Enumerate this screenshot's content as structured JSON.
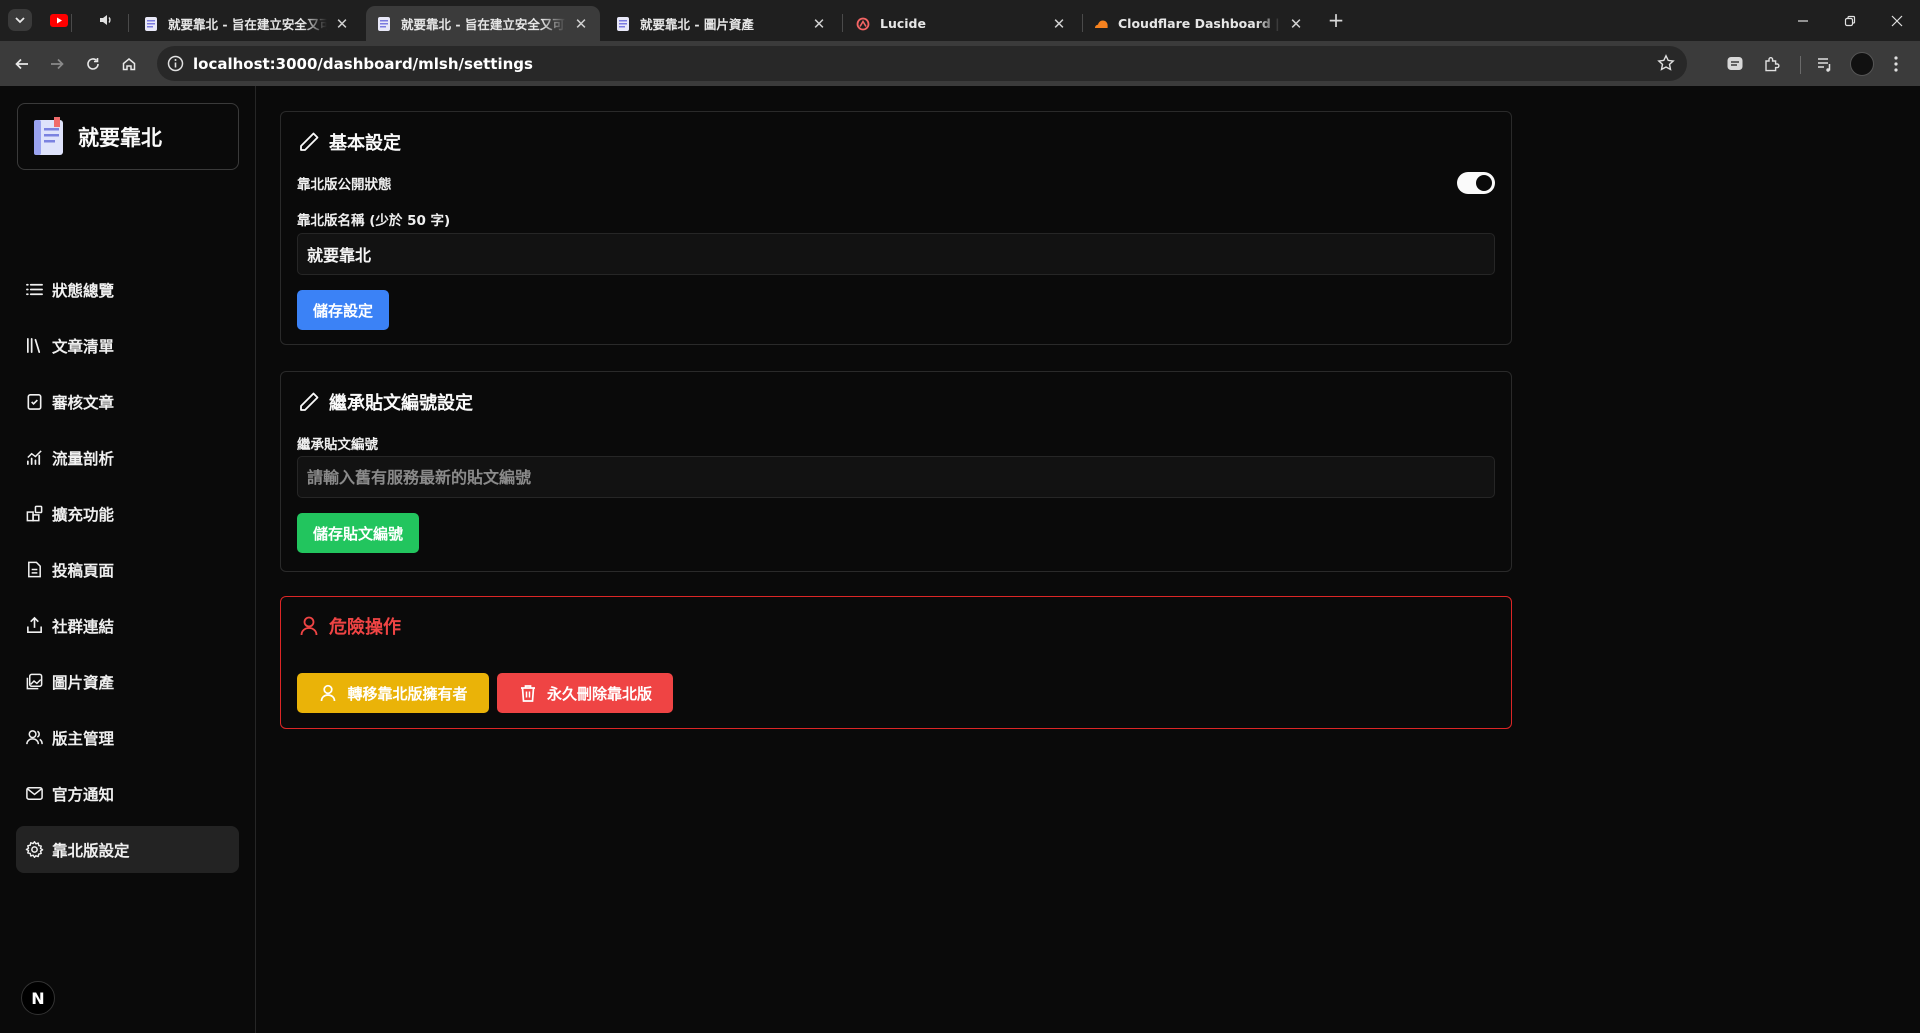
{
  "browser": {
    "tabs": [
      {
        "title": "就要靠北 - 旨在建立安全又可靠",
        "active": false
      },
      {
        "title": "就要靠北 - 旨在建立安全又可靠",
        "active": true
      },
      {
        "title": "就要靠北 - 圖片資產",
        "active": false
      },
      {
        "title": "Lucide",
        "active": false
      },
      {
        "title": "Cloudflare Dashboard | Manage",
        "active": false
      }
    ],
    "close_glyph": "✕",
    "new_tab_glyph": "+",
    "url": "localhost:3000/dashboard/mlsh/settings"
  },
  "sidebar": {
    "brand": "就要靠北",
    "items": [
      {
        "label": "狀態總覽",
        "icon": "list-icon"
      },
      {
        "label": "文章清單",
        "icon": "library-icon"
      },
      {
        "label": "審核文章",
        "icon": "clipboard-check-icon"
      },
      {
        "label": "流量剖析",
        "icon": "chart-icon"
      },
      {
        "label": "擴充功能",
        "icon": "blocks-icon"
      },
      {
        "label": "投稿頁面",
        "icon": "file-text-icon"
      },
      {
        "label": "社群連結",
        "icon": "share-icon"
      },
      {
        "label": "圖片資產",
        "icon": "images-icon"
      },
      {
        "label": "版主管理",
        "icon": "users-icon"
      },
      {
        "label": "官方通知",
        "icon": "mail-icon"
      },
      {
        "label": "靠北版設定",
        "icon": "gear-icon",
        "active": true
      }
    ],
    "badge": "N"
  },
  "basic": {
    "title": "基本設定",
    "public_label": "靠北版公開狀態",
    "public_enabled": true,
    "name_label": "靠北版名稱 (少於 50 字)",
    "name_value": "就要靠北",
    "save_label": "儲存設定"
  },
  "inherit": {
    "title": "繼承貼文編號設定",
    "field_label": "繼承貼文編號",
    "placeholder": "請輸入舊有服務最新的貼文編號",
    "save_label": "儲存貼文編號"
  },
  "danger": {
    "title": "危險操作",
    "transfer_label": "轉移靠北版擁有者",
    "delete_label": "永久刪除靠北版"
  },
  "colors": {
    "primary": "#3b82f6",
    "success": "#22c55e",
    "warning": "#eab308",
    "danger": "#ef4444"
  }
}
